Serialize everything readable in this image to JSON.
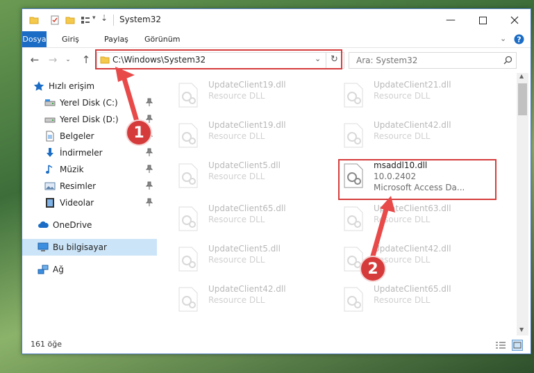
{
  "window": {
    "title": "System32"
  },
  "ribbon": {
    "tabs": [
      "Dosya",
      "Giriş",
      "Paylaş",
      "Görünüm"
    ]
  },
  "address": {
    "path": "C:\\Windows\\System32"
  },
  "search": {
    "placeholder": "Ara: System32"
  },
  "sidebar": {
    "quick_access": "Hızlı erişim",
    "items": [
      {
        "label": "Yerel Disk (C:)",
        "icon": "drive-icon",
        "pinned": true
      },
      {
        "label": "Yerel Disk (D:)",
        "icon": "drive-icon",
        "pinned": true
      },
      {
        "label": "Belgeler",
        "icon": "documents-icon",
        "pinned": true
      },
      {
        "label": "İndirmeler",
        "icon": "download-icon",
        "pinned": true
      },
      {
        "label": "Müzik",
        "icon": "music-icon",
        "pinned": true
      },
      {
        "label": "Resimler",
        "icon": "pictures-icon",
        "pinned": true
      },
      {
        "label": "Videolar",
        "icon": "videos-icon",
        "pinned": true
      }
    ],
    "onedrive": "OneDrive",
    "this_pc": "Bu bilgisayar",
    "network": "Ağ"
  },
  "files": {
    "left": [
      {
        "name": "UpdateClient19.dll",
        "type": "Resource DLL"
      },
      {
        "name": "UpdateClient19.dll",
        "type": "Resource DLL"
      },
      {
        "name": "UpdateClient5.dll",
        "type": "Resource DLL"
      },
      {
        "name": "UpdateClient65.dll",
        "type": "Resource DLL"
      },
      {
        "name": "UpdateClient5.dll",
        "type": "Resource DLL"
      },
      {
        "name": "UpdateClient42.dll",
        "type": "Resource DLL"
      }
    ],
    "right": [
      {
        "name": "UpdateClient21.dll",
        "type": "Resource DLL"
      },
      {
        "name": "UpdateClient42.dll",
        "type": "Resource DLL"
      },
      {
        "name": "msaddl10.dll",
        "version": "10.0.2402",
        "desc": "Microsoft Access Da..."
      },
      {
        "name": "UpdateClient63.dll",
        "type": "Resource DLL"
      },
      {
        "name": "UpdateClient42.dll",
        "type": "Resource DLL"
      },
      {
        "name": "UpdateClient65.dll",
        "type": "Resource DLL"
      }
    ]
  },
  "status": {
    "count": "161 öğe"
  },
  "annotations": {
    "badge1": "1",
    "badge2": "2",
    "color": "#d63b3b"
  }
}
